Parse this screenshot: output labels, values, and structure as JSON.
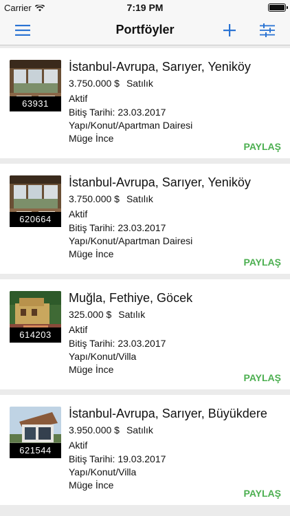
{
  "status": {
    "carrier": "Carrier",
    "time": "7:19 PM"
  },
  "navbar": {
    "title": "Portföyler",
    "menu_icon": "hamburger-menu-icon",
    "add_icon": "plus-icon",
    "filter_icon": "sliders-icon"
  },
  "colors": {
    "accent": "#2a73d3",
    "share": "#4caf50"
  },
  "listings": [
    {
      "id": "63931",
      "location": "İstanbul-Avrupa, Sarıyer, Yeniköy",
      "price": "3.750.000 $",
      "type": "Satılık",
      "status": "Aktif",
      "end_date": "Bitiş Tarihi: 23.03.2017",
      "category": "Yapı/Konut/Apartman Dairesi",
      "agent": "Müge İnce",
      "share_label": "PAYLAŞ"
    },
    {
      "id": "620664",
      "location": "İstanbul-Avrupa, Sarıyer, Yeniköy",
      "price": "3.750.000 $",
      "type": "Satılık",
      "status": "Aktif",
      "end_date": "Bitiş Tarihi: 23.03.2017",
      "category": "Yapı/Konut/Apartman Dairesi",
      "agent": "Müge İnce",
      "share_label": "PAYLAŞ"
    },
    {
      "id": "614203",
      "location": "Muğla, Fethiye, Göcek",
      "price": "325.000 $",
      "type": "Satılık",
      "status": "Aktif",
      "end_date": "Bitiş Tarihi: 23.03.2017",
      "category": "Yapı/Konut/Villa",
      "agent": "Müge İnce",
      "share_label": "PAYLAŞ"
    },
    {
      "id": "621544",
      "location": "İstanbul-Avrupa, Sarıyer, Büyükdere",
      "price": "3.950.000 $",
      "type": "Satılık",
      "status": "Aktif",
      "end_date": "Bitiş Tarihi: 19.03.2017",
      "category": "Yapı/Konut/Villa",
      "agent": "Müge İnce",
      "share_label": "PAYLAŞ"
    }
  ]
}
